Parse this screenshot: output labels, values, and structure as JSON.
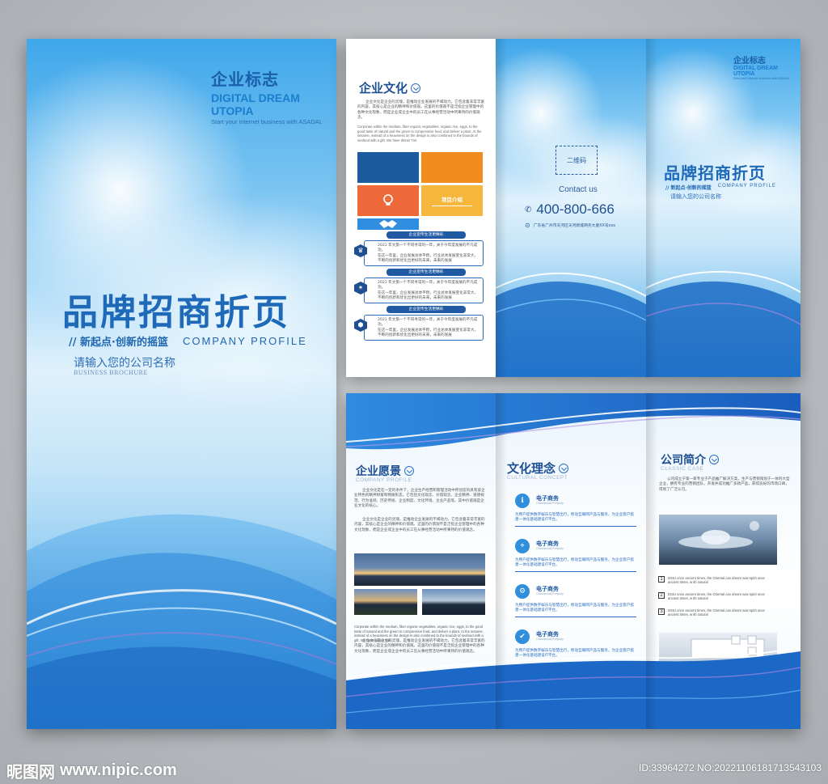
{
  "cover": {
    "logo_cn": "企业标志",
    "logo_en": "DIGITAL DREAM UTOPIA",
    "logo_tag": "Start your internet business with ASADAL",
    "title": "品牌招商折页",
    "slogan": "// 新起点·创新的摇篮",
    "slogan_en": "COMPANY PROFILE",
    "company_name": "请输入您的公司名称",
    "brochure_en": "BUSINESS  BROCHURE"
  },
  "top_panel": {
    "culture_title": "企业文化",
    "culture_body": "企业文化是企业的灵魂，是推动企业发展的不竭动力。它包含着非常丰富的内容，其核心是企业的精神和价值观。这里的价值观不是泛指企业管理中的各种文化现象，而是企业或企业中的员工在从事经营活动中所秉持的价值观念。",
    "culture_body_en": "Corporate within the medium, fiber organic vegetables, organic rice, eggs, to the good taste of natural and the green to compressive food, and deliver a plant. At the sesame, instead of a heaviness on the design is also combined to the bounds of seafood with a gift. We have dinner Tim.",
    "intro_label": "项目介绍",
    "timeline": [
      {
        "pill": "企业宣传生活更精彩",
        "icon": "♛",
        "line1": "2021 年文旅一个不同寻常的一年，关于今年度发展的不凡成功。",
        "line2": "在这一年里，企业发展总体平稳，行业总体发展变化非常大，",
        "line3": "不断的创新和优化出更好的未来，未来的发展"
      },
      {
        "pill": "企业宣传生活更精彩",
        "icon": "✶",
        "line1": "2021 年文旅一个不同寻常的一年，关于今年度发展的不凡成功。",
        "line2": "在这一年里，企业发展总体平稳，行业总体发展变化非常大，",
        "line3": "不断的创新和优化出更好的未来，未来的发展"
      },
      {
        "pill": "企业宣传生活更精彩",
        "icon": "⬢",
        "line1": "2021 年文旅一个不同寻常的一年，关于今年度发展的不凡成功。",
        "line2": "在这一年里，企业发展总体平稳，行业总体发展变化非常大，",
        "line3": "不断的创新和优化出更好的未来，未来的发展"
      }
    ],
    "qr_label": "二维码",
    "contact_label": "Contact us",
    "phone": "400-800-666",
    "address": "广东省广州市天河区天河新城商务大厦XX号xxx",
    "back_logo_cn": "企业标志",
    "back_logo_en": "DIGITAL DREAM UTOPIA",
    "back_logo_tag": "Start your internet business with ASADAL",
    "back_title": "品牌招商折页",
    "back_slogan": "// 新起点·创新的摇篮",
    "back_slogan_en": "COMPANY PROFILE",
    "back_company": "请输入您的公司名称"
  },
  "bottom_panel": {
    "vision_title": "企业愿景",
    "vision_en": "COMPANY PROFILE",
    "vision_body": "企业文化是在一定的条件下，企业生产经营和管理活动中所创造的具有该企业特色的精神财富和物质形态。它包括文化观念、价值观念、企业精神、道德规范、行为准则、历史传统、企业制度、文化环境、企业产品等。其中价值观是企业文化的核心。",
    "vision_body2": "企业文化是企业的灵魂，是推动企业发展的不竭动力。它包含着非常丰富的内容，其核心是企业的精神和价值观。这里的价值观不是泛指企业管理中的各种文化现象，而是企业或企业中的员工在从事经营活动中所秉持的价值观念。",
    "vision_body_en": "Corporate within the medium, fiber organic vegetables, organic rice, eggs, to the good taste of natural and the green to compressive food, and deliver a plant. At the sesame, instead of a heaviness on the design is also combined to the bounds of seafood with a gift. We have dinner Tim.",
    "vision_body3": "企业文化是企业的灵魂，是推动企业发展的不竭动力。它包含着非常丰富的内容，其核心是企业的精神和价值观。这里的价值观不是泛指企业管理中的各种文化现象，而是企业或企业中的员工在从事经营活动中所秉持的价值观念。",
    "concept_title": "文化理念",
    "concept_en": "CULTURAL CONCEPT",
    "ecom": [
      {
        "title": "电子商务",
        "en": "Commercial Property",
        "desc": "为用户提供数字娱乐与智慧出行，移动互联网产品与服务，为企业客户搭建一体化基础建设IT平台。"
      },
      {
        "title": "电子商务",
        "en": "Commercial Property",
        "desc": "为用户提供数字娱乐与智慧出行，移动互联网产品与服务，为企业客户搭建一体化基础建设IT平台。"
      },
      {
        "title": "电子商务",
        "en": "Commercial Property",
        "desc": "为用户提供数字娱乐与智慧出行，移动互联网产品与服务，为企业客户搭建一体化基础建设IT平台。"
      },
      {
        "title": "电子商务",
        "en": "Commercial Property",
        "desc": "为用户提供数字娱乐与智慧出行，移动互联网产品与服务，为企业客户搭建一体化基础建设IT平台。"
      }
    ],
    "intro_title": "公司简介",
    "intro_en": "CLASSIC CASE",
    "intro_body": "公司成立于第一家专业于产品推广解决方案，生产与营销策划于一体的大型企业，拥有专业的营销团队，开发并成功推广多款产品，获得良好的市场口碑，得到了广泛认可。",
    "cases": [
      {
        "num": "1",
        "text": "DSIU once ancient times, the Oriental can dream was spirit once",
        "text2": "ancient times, w ith natural"
      },
      {
        "num": "2",
        "text": "DSIU once ancient times, the Oriental can dream was spirit once",
        "text2": "ancient times, w ith natural"
      },
      {
        "num": "3",
        "text": "DSIU once ancient times, the Oriental can dream was spirit once",
        "text2": "ancient times, w ith natural"
      }
    ]
  },
  "watermark": {
    "site_cn": "昵图网",
    "site_url": "www.nipic.com",
    "id_text": "ID:33964272 NO:20221106181713543103"
  },
  "colors": {
    "brand_blue": "#1e6ab8",
    "navy": "#1d5b9f",
    "orange": "#f18c1f",
    "yellow": "#f6b73c"
  }
}
